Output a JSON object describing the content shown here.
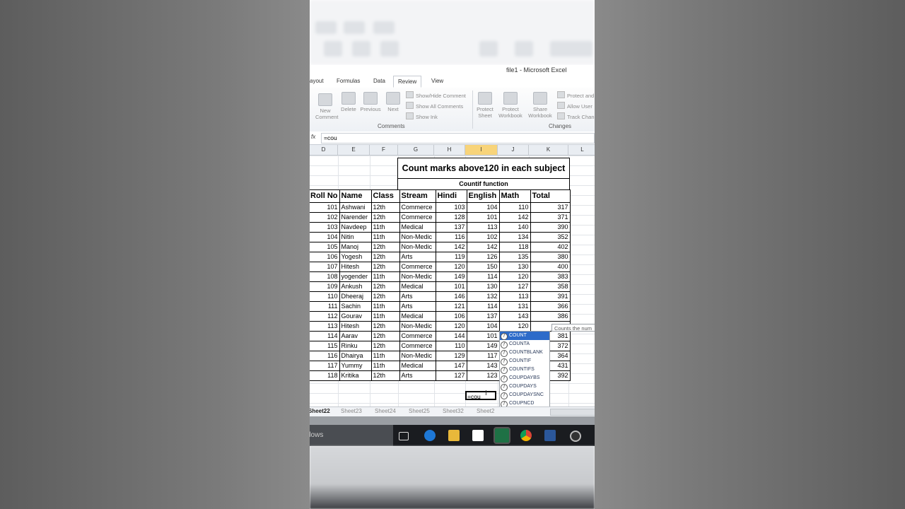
{
  "window": {
    "title": "file1  -  Microsoft Excel"
  },
  "tabs": [
    "ayout",
    "Formulas",
    "Data",
    "Review",
    "View"
  ],
  "active_tab": "Review",
  "ribbon": {
    "comments_group": {
      "label": "Comments",
      "new_comment": "New\nComment",
      "delete": "Delete",
      "previous": "Previous",
      "next": "Next",
      "show_hide": "Show/Hide Comment",
      "show_all": "Show All Comments",
      "show_ink": "Show Ink"
    },
    "changes_group": {
      "label": "Changes",
      "protect_sheet": "Protect\nSheet",
      "protect_workbook": "Protect\nWorkbook",
      "share_workbook": "Share\nWorkbook",
      "protect_and": "Protect and",
      "allow_users": "Allow User",
      "track_changes": "Track Chan"
    }
  },
  "formula_bar": {
    "fx": "fx",
    "value": "=cou"
  },
  "columns": [
    "D",
    "E",
    "F",
    "G",
    "H",
    "I",
    "J",
    "K",
    "L"
  ],
  "selected_column": "I",
  "sheet": {
    "title": "Count marks above120 in each subject",
    "subtitle": "Countif function",
    "headers": [
      "Roll No",
      "Name",
      "Class",
      "Stream",
      "Hindi",
      "English",
      "Math",
      "Total"
    ],
    "rows": [
      [
        "101",
        "Ashwani",
        "12th",
        "Commerce",
        "103",
        "104",
        "110",
        "317"
      ],
      [
        "102",
        "Narender",
        "12th",
        "Commerce",
        "128",
        "101",
        "142",
        "371"
      ],
      [
        "103",
        "Navdeep",
        "11th",
        "Medical",
        "137",
        "113",
        "140",
        "390"
      ],
      [
        "104",
        "Nitin",
        "11th",
        "Non-Medic",
        "116",
        "102",
        "134",
        "352"
      ],
      [
        "105",
        "Manoj",
        "12th",
        "Non-Medic",
        "142",
        "142",
        "118",
        "402"
      ],
      [
        "106",
        "Yogesh",
        "12th",
        "Arts",
        "119",
        "126",
        "135",
        "380"
      ],
      [
        "107",
        "Hitesh",
        "12th",
        "Commerce",
        "120",
        "150",
        "130",
        "400"
      ],
      [
        "108",
        "yogender",
        "11th",
        "Non-Medic",
        "149",
        "114",
        "120",
        "383"
      ],
      [
        "109",
        "Ankush",
        "12th",
        "Medical",
        "101",
        "130",
        "127",
        "358"
      ],
      [
        "110",
        "Dheeraj",
        "12th",
        "Arts",
        "146",
        "132",
        "113",
        "391"
      ],
      [
        "111",
        "Sachin",
        "11th",
        "Arts",
        "121",
        "114",
        "131",
        "366"
      ],
      [
        "112",
        "Gourav",
        "11th",
        "Medical",
        "106",
        "137",
        "143",
        "386"
      ],
      [
        "113",
        "Hitesh",
        "12th",
        "Non-Medic",
        "120",
        "104",
        "120",
        ""
      ],
      [
        "114",
        "Aarav",
        "12th",
        "Commerce",
        "144",
        "101",
        "",
        "381"
      ],
      [
        "115",
        "Rinku",
        "12th",
        "Commerce",
        "110",
        "149",
        "",
        "372"
      ],
      [
        "116",
        "Dhairya",
        "11th",
        "Non-Medic",
        "129",
        "117",
        "",
        "364"
      ],
      [
        "117",
        "Yummy",
        "11th",
        "Medical",
        "147",
        "143",
        "",
        "431"
      ],
      [
        "118",
        "Kritika",
        "12th",
        "Arts",
        "127",
        "123",
        "",
        "392"
      ]
    ],
    "active_cell_text": "=cou"
  },
  "autocomplete": {
    "tooltip": "Counts the num",
    "items": [
      "COUNT",
      "COUNTA",
      "COUNTBLANK",
      "COUNTIF",
      "COUNTIFS",
      "COUPDAYBS",
      "COUPDAYS",
      "COUPDAYSNC",
      "COUPNCD",
      "COUPNUM",
      "COUPPCD"
    ],
    "selected": "COUNT"
  },
  "sheet_tabs": [
    "Sheet22",
    "Sheet23",
    "Sheet24",
    "Sheet25",
    "Sheet32",
    "Sheet2"
  ],
  "active_sheet": "Sheet22",
  "taskbar": {
    "left_text": "dows"
  },
  "colors": {
    "accent_select": "#2d6bc9",
    "column_highlight": "#f8d47a",
    "excel_green": "#1e7145"
  }
}
